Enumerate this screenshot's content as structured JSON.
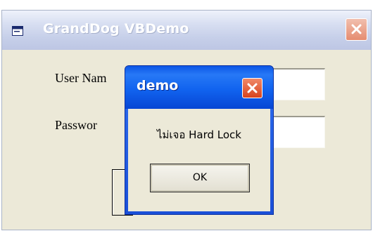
{
  "main_window": {
    "title": "GrandDog VBDemo",
    "user_label": "User Nam",
    "password_label": "Passwor",
    "user_value": "",
    "password_value": "",
    "icon": "app-window-icon",
    "close_icon": "close-icon"
  },
  "message_box": {
    "title": "demo",
    "message": "ไม่เจอ Hard Lock",
    "ok_label": "OK",
    "close_icon": "close-icon"
  },
  "colors": {
    "title_active": "#1163ef",
    "title_inactive": "#c6cfe9",
    "close_active": "#d8431e",
    "dialog_face": "#ece9d8"
  }
}
